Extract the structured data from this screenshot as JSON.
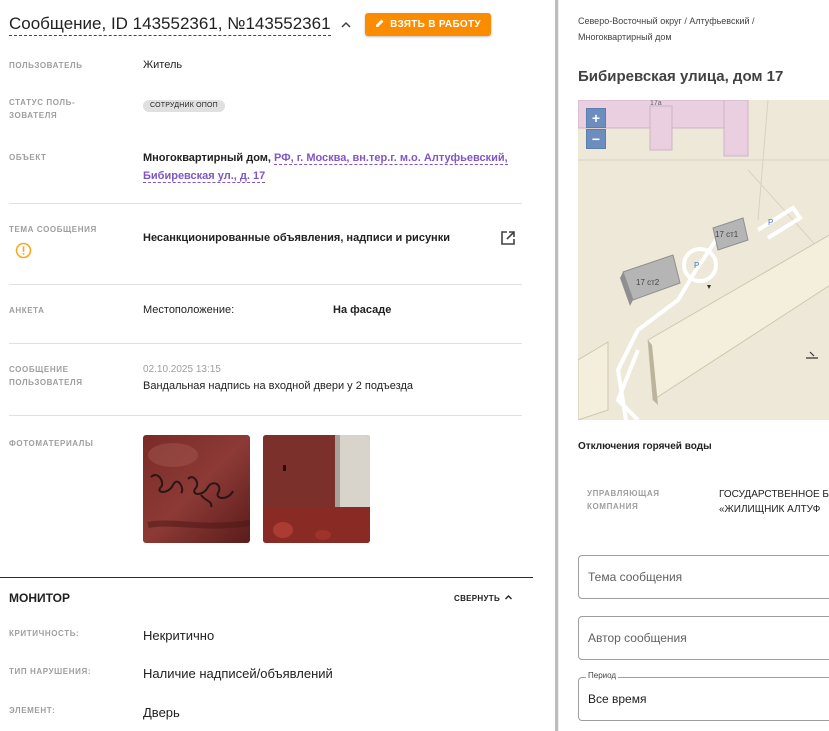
{
  "header": {
    "title": "Сообщение, ID 143552361, №143552361",
    "take_button": "ВЗЯТЬ В РАБОТУ"
  },
  "fields": {
    "user_label": "ПОЛЬЗОВАТЕЛЬ",
    "user_value": "Житель",
    "status_label_1": "СТАТУС ПОЛЬ-",
    "status_label_2": "ЗОВАТЕЛЯ",
    "status_value": "СОТРУДНИК ОПОП",
    "object_label": "ОБЪЕКТ",
    "object_prefix": "Многоквартирный дом, ",
    "object_link_1": "РФ, г. Москва, вн.тер.г. м.о. Алтуфьевский,",
    "object_link_2": "Бибиревская ул., д. 17",
    "topic_label": "ТЕМА СООБЩЕНИЯ",
    "topic_value": "Несанкционированные объявления, надписи и рисунки",
    "survey_label": "АНКЕТА",
    "survey_key": "Местоположение:",
    "survey_value": "На фасаде",
    "msg_label_1": "СООБЩЕНИЕ",
    "msg_label_2": "ПОЛЬЗОВАТЕЛЯ",
    "msg_date": "02.10.2025 13:15",
    "msg_text": "Вандальная надпись на входной двери у 2 подъезда",
    "photos_label": "ФОТОМАТЕРИАЛЫ"
  },
  "monitor": {
    "title": "МОНИТОР",
    "collapse_label": "СВЕРНУТЬ",
    "criticality_label": "КРИТИЧНОСТЬ:",
    "criticality_value": "Некритично",
    "violation_label": "ТИП НАРУШЕНИЯ:",
    "violation_value": "Наличие надписей/объявлений",
    "element_label": "ЭЛЕМЕНТ:",
    "element_value": "Дверь"
  },
  "right": {
    "crumb_1": "Северо-Восточный округ / Алтуфьевский /",
    "crumb_2": "Многоквартирный дом",
    "address": "Бибиревская улица, дом 17",
    "map": {
      "zoom_in": "+",
      "zoom_out": "−",
      "building_1": "17 ст1",
      "building_2": "17 ст2",
      "building_3": "17а",
      "parking": "P"
    },
    "hot_water": "Отключения горячей воды",
    "mgmt_label_1": "УПРАВЛЯЮЩАЯ",
    "mgmt_label_2": "КОМПАНИЯ",
    "mgmt_value_1": "ГОСУДАРСТВЕННОЕ Б",
    "mgmt_value_2": "«ЖИЛИЩНИК АЛТУФ",
    "topic_placeholder": "Тема сообщения",
    "author_placeholder": "Автор сообщения",
    "period_label": "Период",
    "period_value": "Все время"
  },
  "colors": {
    "accent": "#fb8c00",
    "link": "#7e57c2",
    "monitor_line": "#1a237e",
    "warning": "#f9a825"
  }
}
